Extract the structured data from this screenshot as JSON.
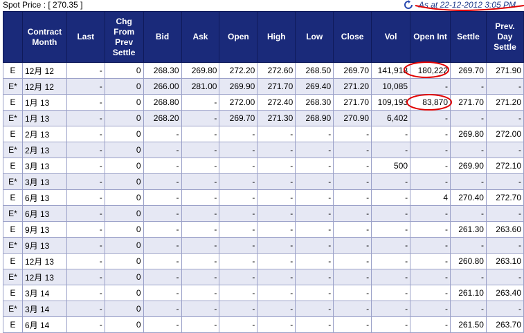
{
  "header": {
    "spot_label": "Spot Price : [ 270.35 ]",
    "as_at": "As at 22-12-2012 3:05 PM"
  },
  "table": {
    "columns": [
      "",
      "Contract Month",
      "Last",
      "Chg From Prev Settle",
      "Bid",
      "Ask",
      "Open",
      "High",
      "Low",
      "Close",
      "Vol",
      "Open Int",
      "Settle",
      "Prev. Day Settle"
    ],
    "rows": [
      [
        "E",
        "12月 12",
        "-",
        "0",
        "268.30",
        "269.80",
        "272.20",
        "272.60",
        "268.50",
        "269.70",
        "141,918",
        "180,222",
        "269.70",
        "271.90"
      ],
      [
        "E*",
        "12月 12",
        "-",
        "0",
        "266.00",
        "281.00",
        "269.90",
        "271.70",
        "269.40",
        "271.20",
        "10,085",
        "-",
        "-",
        "-"
      ],
      [
        "E",
        "1月 13",
        "-",
        "0",
        "268.80",
        "-",
        "272.00",
        "272.40",
        "268.30",
        "271.70",
        "109,193",
        "83,870",
        "271.70",
        "271.20"
      ],
      [
        "E*",
        "1月 13",
        "-",
        "0",
        "268.20",
        "-",
        "269.70",
        "271.30",
        "268.90",
        "270.90",
        "6,402",
        "-",
        "-",
        "-"
      ],
      [
        "E",
        "2月 13",
        "-",
        "0",
        "-",
        "-",
        "-",
        "-",
        "-",
        "-",
        "-",
        "-",
        "269.80",
        "272.00"
      ],
      [
        "E*",
        "2月 13",
        "-",
        "0",
        "-",
        "-",
        "-",
        "-",
        "-",
        "-",
        "-",
        "-",
        "-",
        "-"
      ],
      [
        "E",
        "3月 13",
        "-",
        "0",
        "-",
        "-",
        "-",
        "-",
        "-",
        "-",
        "500",
        "-",
        "269.90",
        "272.10"
      ],
      [
        "E*",
        "3月 13",
        "-",
        "0",
        "-",
        "-",
        "-",
        "-",
        "-",
        "-",
        "-",
        "-",
        "-",
        "-"
      ],
      [
        "E",
        "6月 13",
        "-",
        "0",
        "-",
        "-",
        "-",
        "-",
        "-",
        "-",
        "-",
        "4",
        "270.40",
        "272.70"
      ],
      [
        "E*",
        "6月 13",
        "-",
        "0",
        "-",
        "-",
        "-",
        "-",
        "-",
        "-",
        "-",
        "-",
        "-",
        "-"
      ],
      [
        "E",
        "9月 13",
        "-",
        "0",
        "-",
        "-",
        "-",
        "-",
        "-",
        "-",
        "-",
        "-",
        "261.30",
        "263.60"
      ],
      [
        "E*",
        "9月 13",
        "-",
        "0",
        "-",
        "-",
        "-",
        "-",
        "-",
        "-",
        "-",
        "-",
        "-",
        "-"
      ],
      [
        "E",
        "12月 13",
        "-",
        "0",
        "-",
        "-",
        "-",
        "-",
        "-",
        "-",
        "-",
        "-",
        "260.80",
        "263.10"
      ],
      [
        "E*",
        "12月 13",
        "-",
        "0",
        "-",
        "-",
        "-",
        "-",
        "-",
        "-",
        "-",
        "-",
        "-",
        "-"
      ],
      [
        "E",
        "3月 14",
        "-",
        "0",
        "-",
        "-",
        "-",
        "-",
        "-",
        "-",
        "-",
        "-",
        "261.10",
        "263.40"
      ],
      [
        "E*",
        "3月 14",
        "-",
        "0",
        "-",
        "-",
        "-",
        "-",
        "-",
        "-",
        "-",
        "-",
        "-",
        "-"
      ],
      [
        "E",
        "6月 14",
        "-",
        "0",
        "-",
        "-",
        "-",
        "-",
        "-",
        "-",
        "-",
        "-",
        "261.50",
        "263.70"
      ]
    ]
  },
  "colors": {
    "header_bg": "#1a2a7a",
    "alt_row_bg": "#e6e8f4",
    "annotation_red": "#e00000"
  },
  "icons": {
    "refresh": "refresh-icon"
  }
}
